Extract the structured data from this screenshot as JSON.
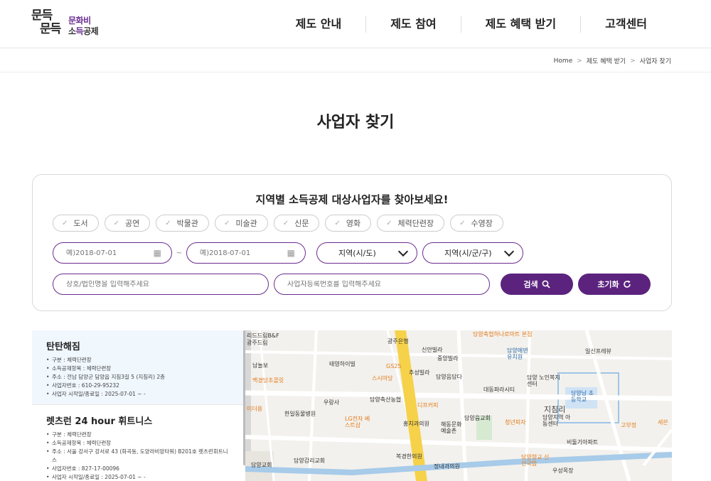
{
  "header": {
    "logo_mark_1": "문득",
    "logo_mark_2": "문득",
    "logo_text_1": "문화비",
    "logo_text_2a": "소",
    "logo_text_2b": "득",
    "logo_text_2c": "공제",
    "nav": [
      "제도 안내",
      "제도 참여",
      "제도 혜택 받기",
      "고객센터"
    ]
  },
  "breadcrumb": [
    "Home",
    "제도 혜택 받기",
    "사업자 찾기"
  ],
  "page_title": "사업자 찾기",
  "search": {
    "heading": "지역별 소득공제 대상사업자를 찾아보세요!",
    "categories": [
      "도서",
      "공연",
      "박물관",
      "미술관",
      "신문",
      "영화",
      "체력단련장",
      "수영장"
    ],
    "date_from_placeholder": "예)2018-07-01",
    "date_to_placeholder": "예)2018-07-01",
    "date_sep": "~",
    "region1": "지역(시/도)",
    "region2": "지역(시/군/구)",
    "name_placeholder": "상호/법인명을 입력해주세요",
    "bizno_placeholder": "사업자등록번호를 입력해주세요",
    "search_label": "검색",
    "reset_label": "초기화"
  },
  "results": [
    {
      "name": "탄탄해짐",
      "lines": [
        "구분 : 체력단련장",
        "소득공제항목 : 체력단련장",
        "주소 : 전남 담양군 담양읍 지침3길 5 (지침리) 2층",
        "사업자번호 : 610-29-95232",
        "사업자 시작일/종료일 : 2025-07-01 ~ -"
      ]
    },
    {
      "name": "렛츠런 24 hour 휘트니스",
      "lines": [
        "구분 : 체력단련장",
        "소득공제항목 : 체력단련장",
        "주소 : 서울 강서구 강서로 43 (화곡동, 도양라비앙타워) B201호 렛츠런휘트니스",
        "사업자번호 : 827-17-00096",
        "사업자 시작일/종료일 : 2025-07-01 ~ -"
      ]
    }
  ],
  "map": {
    "pois": [
      "리드드림B&F",
      "광주드림",
      "남놀보",
      "백경당초콜릿",
      "미더용",
      "한일동물병원",
      "우랑사",
      "태영하이빌",
      "GS25",
      "스시마당",
      "LG전자 베스트샵",
      "담양축산농협",
      "광주은행",
      "신안빌라",
      "중앙빌라",
      "추성빌라",
      "담양음담다",
      "디프커피",
      "홍치과의원",
      "해동문화 예술촌",
      "담양읍교회",
      "복경한의원",
      "정내과의원",
      "담양감리교회",
      "담양교회",
      "담양축협하나로마트 본점",
      "담양에덴 유치원",
      "일신프레뷰",
      "대동파라시티",
      "담양 노인복지센터",
      "담양남 초등학교",
      "지침리",
      "담양지역 아동센터",
      "청년피자",
      "고부정",
      "비둘기아파트",
      "담양향교 신선국밥",
      "우성목장",
      "세븐"
    ]
  }
}
